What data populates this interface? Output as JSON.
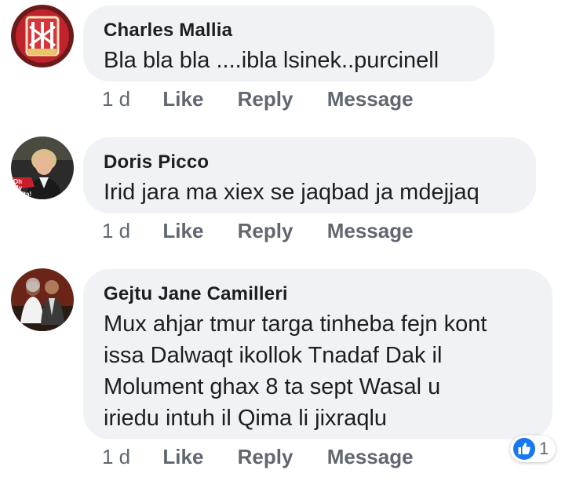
{
  "comments": [
    {
      "author": "Charles Mallia",
      "text": "Bla bla bla ....ibla lsinek..purcinell",
      "time": "1 d",
      "actions": [
        "Like",
        "Reply",
        "Message"
      ]
    },
    {
      "author": "Doris Picco",
      "text": "Irid jara ma xiex se jaqbad ja mdejjaq",
      "time": "1 d",
      "actions": [
        "Like",
        "Reply",
        "Message"
      ],
      "avatar_badge": "Oh My Malta!"
    },
    {
      "author": "Gejtu Jane Camilleri",
      "text_lines": [
        "Mux ahjar tmur targa tinheba fejn kont",
        "issa Dalwaqt ikollok Tnadaf Dak il",
        "Molument ghax 8 ta sept Wasal u",
        "iriedu intuh il Qima li jixraqlu"
      ],
      "time": "1 d",
      "actions": [
        "Like",
        "Reply",
        "Message"
      ],
      "reaction": {
        "icon": "thumbs-up-icon",
        "count": "1",
        "color": "#1877f2"
      }
    }
  ],
  "colors": {
    "bubble": "#f0f2f5",
    "meta": "#606770",
    "text": "#1c1e21"
  }
}
